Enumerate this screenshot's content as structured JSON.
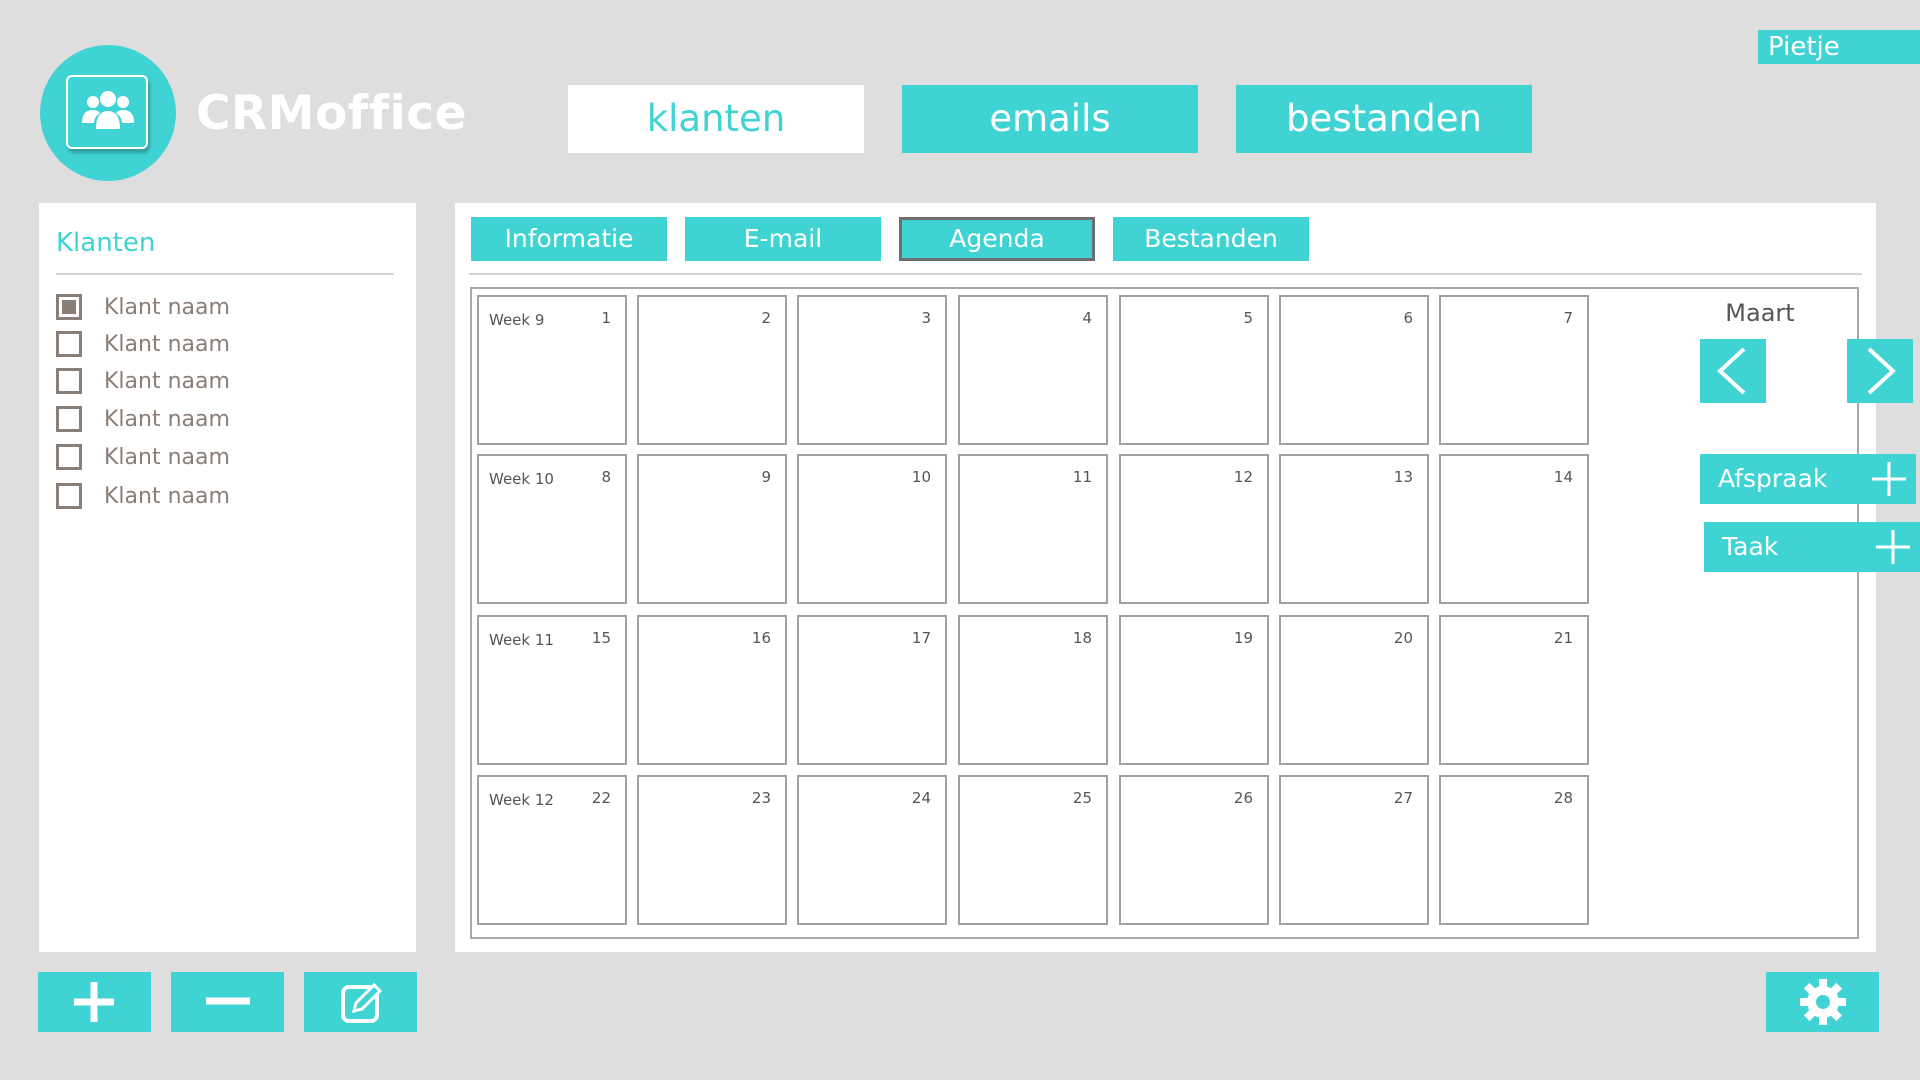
{
  "user": {
    "name": "Pietje"
  },
  "app": {
    "name": "CRMoffice",
    "logo_icon": "users-icon"
  },
  "top_nav": [
    {
      "label": "klanten",
      "active": true
    },
    {
      "label": "emails",
      "active": false
    },
    {
      "label": "bestanden",
      "active": false
    }
  ],
  "sidebar": {
    "title": "Klanten",
    "clients": [
      {
        "label": "Klant naam",
        "checked": true
      },
      {
        "label": "Klant naam",
        "checked": false
      },
      {
        "label": "Klant naam",
        "checked": false
      },
      {
        "label": "Klant naam",
        "checked": false
      },
      {
        "label": "Klant naam",
        "checked": false
      },
      {
        "label": "Klant naam",
        "checked": false
      }
    ]
  },
  "tabs": [
    {
      "label": "Informatie",
      "active": false
    },
    {
      "label": "E-mail",
      "active": false
    },
    {
      "label": "Agenda",
      "active": true
    },
    {
      "label": "Bestanden",
      "active": false
    }
  ],
  "calendar": {
    "month": "Maart",
    "weeks": [
      {
        "label": "Week 9",
        "days": [
          "1",
          "2",
          "3",
          "4",
          "5",
          "6",
          "7"
        ]
      },
      {
        "label": "Week 10",
        "days": [
          "8",
          "9",
          "10",
          "11",
          "12",
          "13",
          "14"
        ]
      },
      {
        "label": "Week 11",
        "days": [
          "15",
          "16",
          "17",
          "18",
          "19",
          "20",
          "21"
        ]
      },
      {
        "label": "Week 12",
        "days": [
          "22",
          "23",
          "24",
          "25",
          "26",
          "27",
          "28"
        ]
      }
    ]
  },
  "actions": {
    "appointment": "Afspraak",
    "task": "Taak"
  },
  "bottom_buttons": [
    "add-icon",
    "remove-icon",
    "edit-icon"
  ],
  "colors": {
    "accent": "#40d3d4",
    "background": "#dedede",
    "text_muted": "#8a7e78"
  }
}
